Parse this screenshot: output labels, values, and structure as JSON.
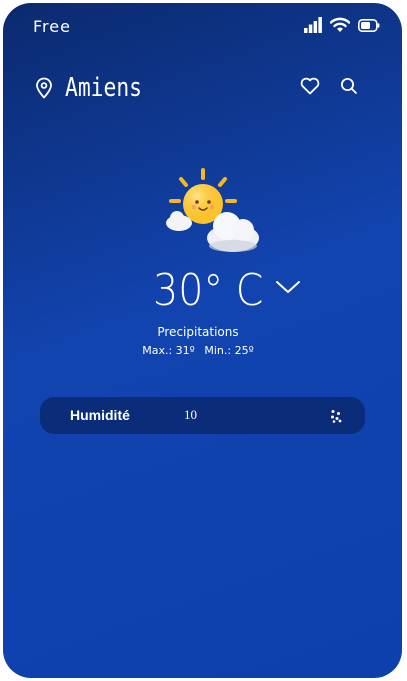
{
  "status_bar": {
    "carrier": "Free",
    "icons": [
      "signal-icon",
      "wifi-icon",
      "battery-icon"
    ]
  },
  "header": {
    "city": "Amiens",
    "icons": [
      "location-pin-icon",
      "heart-icon",
      "search-icon"
    ]
  },
  "weather": {
    "condition_icon": "sun-behind-cloud-icon",
    "temperature": "30° C",
    "description": "Precipitations",
    "max_label": "Max.: 31º",
    "min_label": "Min.: 25º"
  },
  "humidity": {
    "label": "Humidité",
    "value": "10",
    "icon": "droplets-icon"
  },
  "colors": {
    "background_top": "#0b2a6e",
    "background_bottom": "#0d40ac",
    "card": "#0a286e",
    "text": "#ffffff"
  }
}
